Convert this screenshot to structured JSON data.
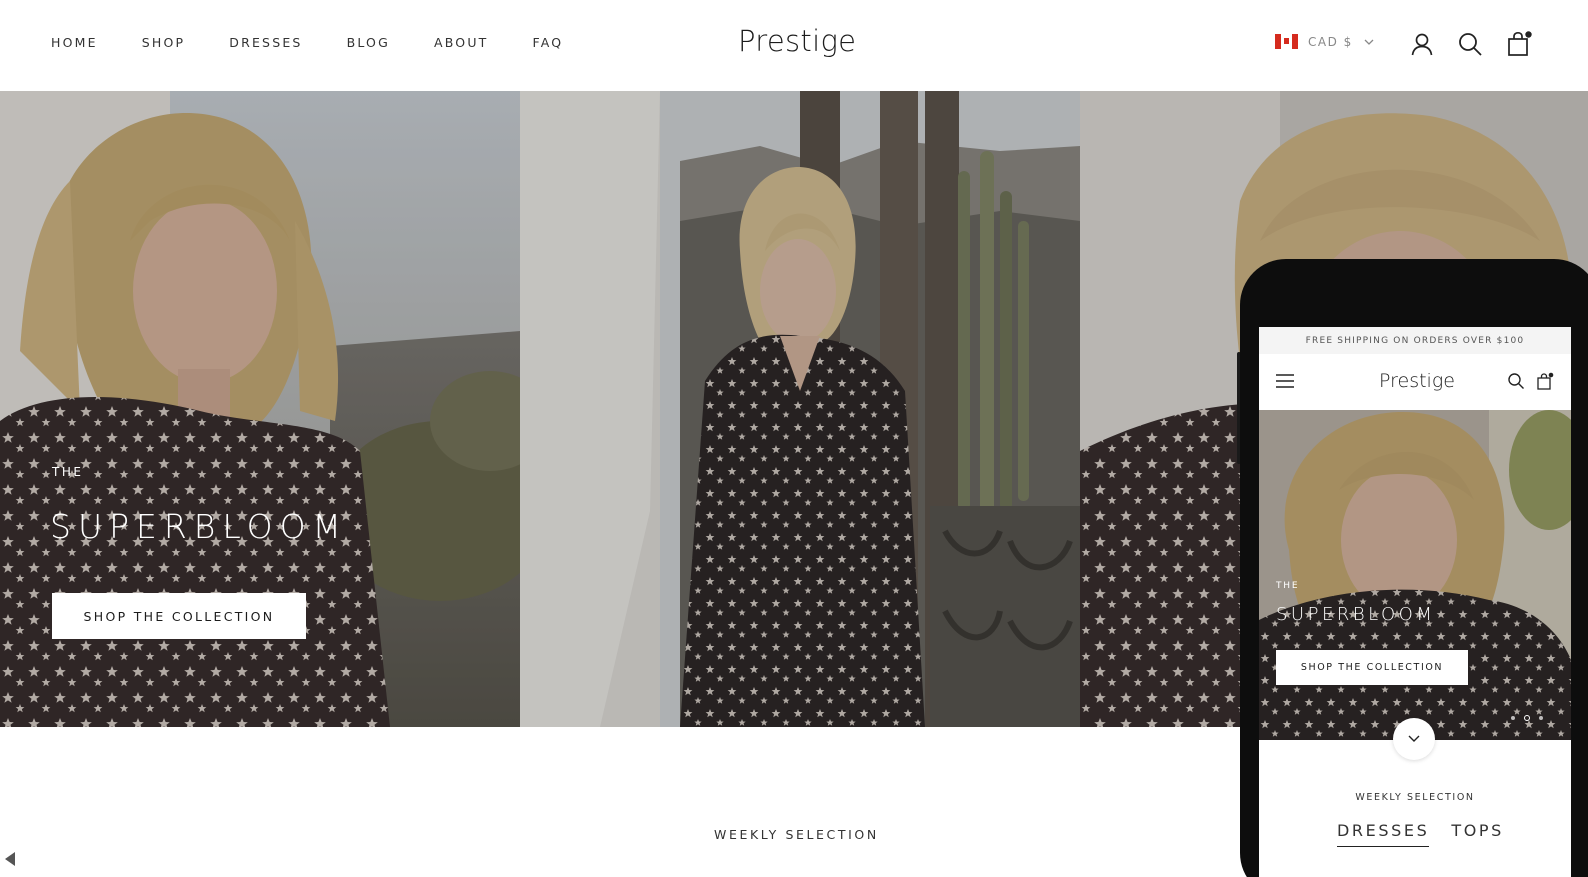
{
  "header": {
    "nav": [
      "HOME",
      "SHOP",
      "DRESSES",
      "BLOG",
      "ABOUT",
      "FAQ"
    ],
    "logo": "Prestige",
    "currency": "CAD $",
    "icons": [
      "account-icon",
      "search-icon",
      "cart-icon"
    ]
  },
  "hero": {
    "kicker": "THE",
    "title": "SUPERBLOOM",
    "button": "SHOP THE COLLECTION"
  },
  "weekly": {
    "heading": "WEEKLY SELECTION"
  },
  "mobile": {
    "announcement": "FREE SHIPPING ON ORDERS OVER $100",
    "logo": "Prestige",
    "hero": {
      "kicker": "THE",
      "title": "SUPERBLOOM",
      "button": "SHOP THE COLLECTION",
      "active_slide": 2,
      "slide_count": 3
    },
    "weekly_heading": "WEEKLY SELECTION",
    "tabs": [
      {
        "label": "DRESSES",
        "active": true
      },
      {
        "label": "TOPS",
        "active": false
      }
    ]
  },
  "colors": {
    "text": "#1c1c1c",
    "background": "#ffffff",
    "flag_red": "#d52b1e"
  }
}
